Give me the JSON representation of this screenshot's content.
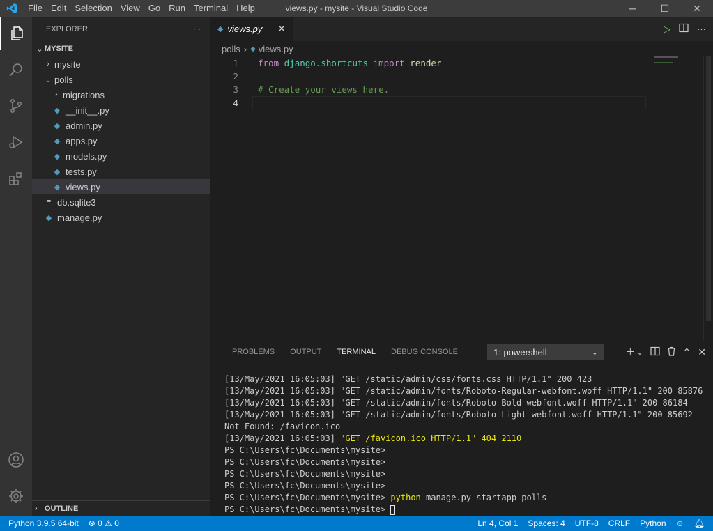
{
  "titlebar": {
    "menu": [
      "File",
      "Edit",
      "Selection",
      "View",
      "Go",
      "Run",
      "Terminal",
      "Help"
    ],
    "title": "views.py - mysite - Visual Studio Code",
    "minimize": "─",
    "maximize": "☐",
    "close": "✕"
  },
  "sidebar": {
    "header": "EXPLORER",
    "more": "···",
    "root": "MYSITE",
    "items": [
      {
        "label": "mysite",
        "type": "folder",
        "expanded": false,
        "depth": 1
      },
      {
        "label": "polls",
        "type": "folder",
        "expanded": true,
        "depth": 1
      },
      {
        "label": "migrations",
        "type": "folder",
        "expanded": false,
        "depth": 2
      },
      {
        "label": "__init__.py",
        "type": "py",
        "depth": 2
      },
      {
        "label": "admin.py",
        "type": "py",
        "depth": 2
      },
      {
        "label": "apps.py",
        "type": "py",
        "depth": 2
      },
      {
        "label": "models.py",
        "type": "py",
        "depth": 2
      },
      {
        "label": "tests.py",
        "type": "py",
        "depth": 2
      },
      {
        "label": "views.py",
        "type": "py",
        "depth": 2,
        "selected": true
      },
      {
        "label": "db.sqlite3",
        "type": "db",
        "depth": 1
      },
      {
        "label": "manage.py",
        "type": "py",
        "depth": 1
      }
    ],
    "outline": "OUTLINE"
  },
  "editor": {
    "tab": "views.py",
    "breadcrumb": [
      "polls",
      "views.py"
    ],
    "lines": [
      {
        "n": "1",
        "code": [
          {
            "t": "from",
            "c": "kw"
          },
          {
            "t": " ",
            "c": ""
          },
          {
            "t": "django.shortcuts",
            "c": "mod"
          },
          {
            "t": " ",
            "c": ""
          },
          {
            "t": "import",
            "c": "kw"
          },
          {
            "t": " ",
            "c": ""
          },
          {
            "t": "render",
            "c": "fn"
          }
        ]
      },
      {
        "n": "2",
        "code": []
      },
      {
        "n": "3",
        "code": [
          {
            "t": "# Create your views here.",
            "c": "cm"
          }
        ]
      },
      {
        "n": "4",
        "code": [],
        "current": true
      }
    ]
  },
  "panel": {
    "tabs": [
      "PROBLEMS",
      "OUTPUT",
      "TERMINAL",
      "DEBUG CONSOLE"
    ],
    "active_tab": "TERMINAL",
    "terminal_select": "1: powershell",
    "terminal_lines": [
      [
        {
          "t": "[13/May/2021 16:05:03] \"GET /static/admin/css/fonts.css HTTP/1.1\" 200 423",
          "c": ""
        }
      ],
      [
        {
          "t": "[13/May/2021 16:05:03] \"GET /static/admin/fonts/Roboto-Regular-webfont.woff HTTP/1.1\" 200 85876",
          "c": ""
        }
      ],
      [
        {
          "t": "[13/May/2021 16:05:03] \"GET /static/admin/fonts/Roboto-Bold-webfont.woff HTTP/1.1\" 200 86184",
          "c": ""
        }
      ],
      [
        {
          "t": "[13/May/2021 16:05:03] \"GET /static/admin/fonts/Roboto-Light-webfont.woff HTTP/1.1\" 200 85692",
          "c": ""
        }
      ],
      [
        {
          "t": "Not Found: /favicon.ico",
          "c": ""
        }
      ],
      [
        {
          "t": "[13/May/2021 16:05:03] ",
          "c": ""
        },
        {
          "t": "\"GET /favicon.ico HTTP/1.1\" 404 2110",
          "c": "yel"
        }
      ],
      [
        {
          "t": "PS C:\\Users\\fc\\Documents\\mysite>",
          "c": ""
        }
      ],
      [
        {
          "t": "PS C:\\Users\\fc\\Documents\\mysite>",
          "c": ""
        }
      ],
      [
        {
          "t": "PS C:\\Users\\fc\\Documents\\mysite>",
          "c": ""
        }
      ],
      [
        {
          "t": "PS C:\\Users\\fc\\Documents\\mysite>",
          "c": ""
        }
      ],
      [
        {
          "t": "PS C:\\Users\\fc\\Documents\\mysite> ",
          "c": ""
        },
        {
          "t": "python",
          "c": "yel"
        },
        {
          "t": " manage.py startapp polls",
          "c": ""
        }
      ],
      [
        {
          "t": "PS C:\\Users\\fc\\Documents\\mysite> ",
          "c": ""
        },
        {
          "t": "",
          "c": "cursor"
        }
      ]
    ]
  },
  "statusbar": {
    "python": "Python 3.9.5 64-bit",
    "errors": "0",
    "warnings": "0",
    "position": "Ln 4, Col 1",
    "spaces": "Spaces: 4",
    "encoding": "UTF-8",
    "eol": "CRLF",
    "language": "Python"
  },
  "colors": {
    "accent": "#007acc",
    "python_icon": "#519aba"
  }
}
